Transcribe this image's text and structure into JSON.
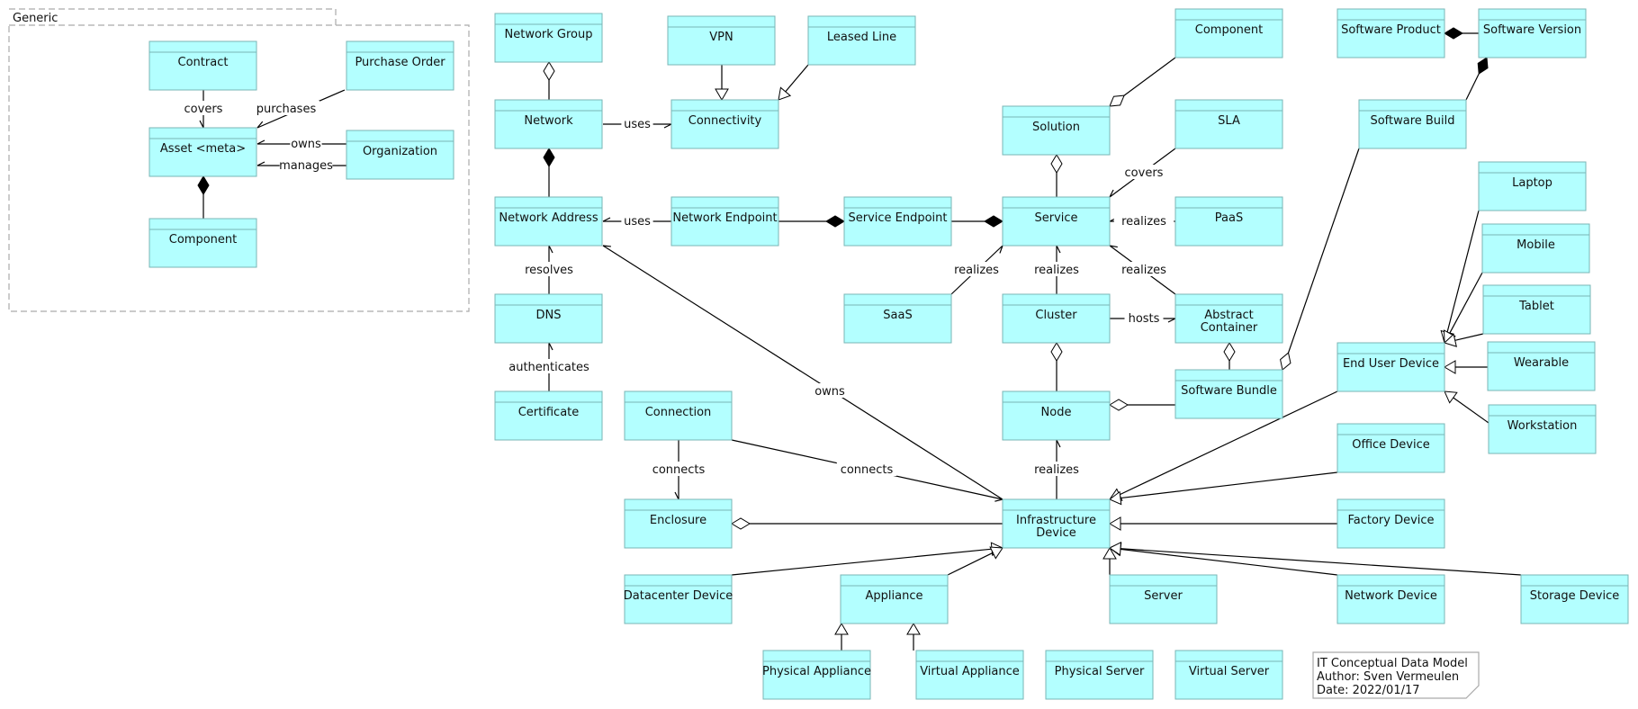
{
  "diagram_title": "IT Conceptual Data Model",
  "package": {
    "id": "generic",
    "label": "Generic"
  },
  "note": {
    "lines": [
      "IT Conceptual Data Model",
      "Author: Sven Vermeulen",
      "Date: 2022/01/17"
    ]
  },
  "colors": {
    "class_fill": "#b3ffff",
    "class_border": "#7ab5b5",
    "line": "#000000",
    "package_border": "#aaaaaa"
  },
  "classes": [
    {
      "id": "contract",
      "label": "Contract",
      "package": "generic"
    },
    {
      "id": "purchase_order",
      "label": "Purchase Order",
      "package": "generic"
    },
    {
      "id": "asset",
      "label": "Asset <meta>",
      "package": "generic"
    },
    {
      "id": "organization",
      "label": "Organization",
      "package": "generic"
    },
    {
      "id": "generic_component",
      "label": "Component",
      "package": "generic"
    },
    {
      "id": "network_group",
      "label": "Network Group"
    },
    {
      "id": "vpn",
      "label": "VPN"
    },
    {
      "id": "leased_line",
      "label": "Leased Line"
    },
    {
      "id": "network",
      "label": "Network"
    },
    {
      "id": "connectivity",
      "label": "Connectivity"
    },
    {
      "id": "network_address",
      "label": "Network Address"
    },
    {
      "id": "network_endpoint",
      "label": "Network Endpoint"
    },
    {
      "id": "service_endpoint",
      "label": "Service Endpoint"
    },
    {
      "id": "dns",
      "label": "DNS"
    },
    {
      "id": "certificate",
      "label": "Certificate"
    },
    {
      "id": "connection",
      "label": "Connection"
    },
    {
      "id": "enclosure",
      "label": "Enclosure"
    },
    {
      "id": "datacenter_device",
      "label": "Datacenter Device"
    },
    {
      "id": "appliance",
      "label": "Appliance"
    },
    {
      "id": "physical_appliance",
      "label": "Physical Appliance"
    },
    {
      "id": "virtual_appliance",
      "label": "Virtual Appliance"
    },
    {
      "id": "component",
      "label": "Component"
    },
    {
      "id": "solution",
      "label": "Solution"
    },
    {
      "id": "sla",
      "label": "SLA"
    },
    {
      "id": "service",
      "label": "Service"
    },
    {
      "id": "paas",
      "label": "PaaS"
    },
    {
      "id": "saas",
      "label": "SaaS"
    },
    {
      "id": "cluster",
      "label": "Cluster"
    },
    {
      "id": "abstract_container",
      "label": "Abstract\nContainer"
    },
    {
      "id": "software_bundle",
      "label": "Software Bundle"
    },
    {
      "id": "node",
      "label": "Node"
    },
    {
      "id": "infrastructure_device",
      "label": "Infrastructure\nDevice"
    },
    {
      "id": "server",
      "label": "Server"
    },
    {
      "id": "physical_server",
      "label": "Physical Server"
    },
    {
      "id": "virtual_server",
      "label": "Virtual Server"
    },
    {
      "id": "software_product",
      "label": "Software Product"
    },
    {
      "id": "software_version",
      "label": "Software Version"
    },
    {
      "id": "software_build",
      "label": "Software Build"
    },
    {
      "id": "laptop",
      "label": "Laptop"
    },
    {
      "id": "mobile",
      "label": "Mobile"
    },
    {
      "id": "tablet",
      "label": "Tablet"
    },
    {
      "id": "end_user_device",
      "label": "End User Device"
    },
    {
      "id": "wearable",
      "label": "Wearable"
    },
    {
      "id": "workstation",
      "label": "Workstation"
    },
    {
      "id": "office_device",
      "label": "Office Device"
    },
    {
      "id": "factory_device",
      "label": "Factory Device"
    },
    {
      "id": "network_device",
      "label": "Network Device"
    },
    {
      "id": "storage_device",
      "label": "Storage Device"
    }
  ],
  "relations": [
    {
      "from": "contract",
      "to": "asset",
      "type": "association",
      "label": "covers"
    },
    {
      "from": "purchase_order",
      "to": "asset",
      "type": "association",
      "label": "purchases"
    },
    {
      "from": "organization",
      "to": "asset",
      "type": "association",
      "label": "owns"
    },
    {
      "from": "organization",
      "to": "asset",
      "type": "association",
      "label": "manages"
    },
    {
      "from": "generic_component",
      "to": "asset",
      "type": "composition",
      "label": ""
    },
    {
      "from": "network",
      "to": "network_group",
      "type": "aggregation",
      "label": ""
    },
    {
      "from": "vpn",
      "to": "connectivity",
      "type": "generalization",
      "label": ""
    },
    {
      "from": "leased_line",
      "to": "connectivity",
      "type": "generalization",
      "label": ""
    },
    {
      "from": "network",
      "to": "connectivity",
      "type": "association",
      "label": "uses"
    },
    {
      "from": "network_address",
      "to": "network",
      "type": "composition",
      "label": ""
    },
    {
      "from": "network_endpoint",
      "to": "network_address",
      "type": "association",
      "label": "uses"
    },
    {
      "from": "network_endpoint",
      "to": "service_endpoint",
      "type": "composition",
      "label": ""
    },
    {
      "from": "service_endpoint",
      "to": "service",
      "type": "composition",
      "label": ""
    },
    {
      "from": "dns",
      "to": "network_address",
      "type": "association",
      "label": "resolves"
    },
    {
      "from": "certificate",
      "to": "dns",
      "type": "association",
      "label": "authenticates"
    },
    {
      "from": "infrastructure_device",
      "to": "network_address",
      "type": "association",
      "label": "owns"
    },
    {
      "from": "connection",
      "to": "enclosure",
      "type": "association",
      "label": "connects"
    },
    {
      "from": "connection",
      "to": "infrastructure_device",
      "type": "association",
      "label": "connects"
    },
    {
      "from": "infrastructure_device",
      "to": "enclosure",
      "type": "aggregation",
      "label": ""
    },
    {
      "from": "datacenter_device",
      "to": "infrastructure_device",
      "type": "generalization",
      "label": ""
    },
    {
      "from": "appliance",
      "to": "infrastructure_device",
      "type": "generalization",
      "label": ""
    },
    {
      "from": "physical_appliance",
      "to": "appliance",
      "type": "generalization",
      "label": ""
    },
    {
      "from": "virtual_appliance",
      "to": "appliance",
      "type": "generalization",
      "label": ""
    },
    {
      "from": "component",
      "to": "solution",
      "type": "aggregation",
      "label": ""
    },
    {
      "from": "service",
      "to": "solution",
      "type": "aggregation",
      "label": ""
    },
    {
      "from": "sla",
      "to": "service",
      "type": "association",
      "label": "covers"
    },
    {
      "from": "paas",
      "to": "service",
      "type": "association",
      "label": "realizes"
    },
    {
      "from": "saas",
      "to": "service",
      "type": "association",
      "label": "realizes"
    },
    {
      "from": "cluster",
      "to": "service",
      "type": "association",
      "label": "realizes"
    },
    {
      "from": "abstract_container",
      "to": "service",
      "type": "association",
      "label": "realizes"
    },
    {
      "from": "cluster",
      "to": "abstract_container",
      "type": "association",
      "label": "hosts"
    },
    {
      "from": "node",
      "to": "cluster",
      "type": "aggregation",
      "label": ""
    },
    {
      "from": "software_bundle",
      "to": "abstract_container",
      "type": "aggregation",
      "label": ""
    },
    {
      "from": "software_bundle",
      "to": "node",
      "type": "aggregation",
      "label": ""
    },
    {
      "from": "software_build",
      "to": "software_bundle",
      "type": "aggregation",
      "label": ""
    },
    {
      "from": "infrastructure_device",
      "to": "node",
      "type": "association",
      "label": "realizes"
    },
    {
      "from": "software_version",
      "to": "software_product",
      "type": "composition",
      "label": ""
    },
    {
      "from": "software_build",
      "to": "software_version",
      "type": "composition",
      "label": ""
    },
    {
      "from": "laptop",
      "to": "end_user_device",
      "type": "generalization",
      "label": ""
    },
    {
      "from": "mobile",
      "to": "end_user_device",
      "type": "generalization",
      "label": ""
    },
    {
      "from": "tablet",
      "to": "end_user_device",
      "type": "generalization",
      "label": ""
    },
    {
      "from": "wearable",
      "to": "end_user_device",
      "type": "generalization",
      "label": ""
    },
    {
      "from": "workstation",
      "to": "end_user_device",
      "type": "generalization",
      "label": ""
    },
    {
      "from": "end_user_device",
      "to": "infrastructure_device",
      "type": "generalization",
      "label": ""
    },
    {
      "from": "office_device",
      "to": "infrastructure_device",
      "type": "generalization",
      "label": ""
    },
    {
      "from": "factory_device",
      "to": "infrastructure_device",
      "type": "generalization",
      "label": ""
    },
    {
      "from": "server",
      "to": "infrastructure_device",
      "type": "generalization",
      "label": ""
    },
    {
      "from": "physical_server",
      "to": "server",
      "type": "generalization",
      "label": ""
    },
    {
      "from": "virtual_server",
      "to": "server",
      "type": "generalization",
      "label": ""
    },
    {
      "from": "network_device",
      "to": "infrastructure_device",
      "type": "generalization",
      "label": ""
    },
    {
      "from": "storage_device",
      "to": "infrastructure_device",
      "type": "generalization",
      "label": ""
    }
  ]
}
